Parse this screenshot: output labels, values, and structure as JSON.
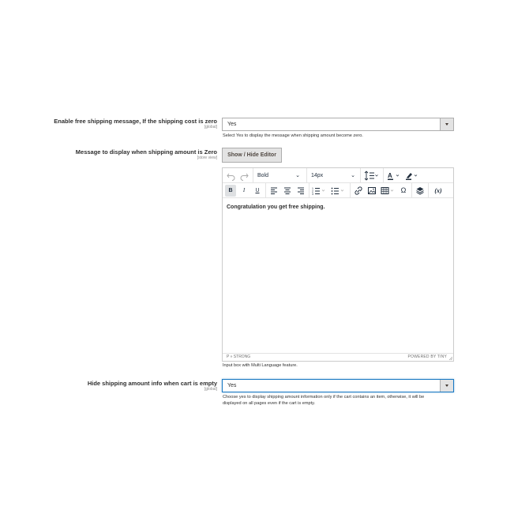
{
  "field_free_shipping": {
    "label": "Enable free shipping message, If the shipping cost is zero",
    "scope": "[global]",
    "value": "Yes",
    "note": "Select Yes to display the message when shipping amount become zero."
  },
  "field_message": {
    "label": "Message to display when shipping amount is Zero",
    "scope": "[store view]",
    "toggle_button": "Show / Hide Editor",
    "editor": {
      "format_select": "Bold",
      "size_select": "14px",
      "variable_button": "(x)",
      "content": "Congratulation you get free shipping.",
      "status_path": "P » STRONG",
      "branding": "POWERED BY TINY"
    },
    "note": "Input box with Multi Language feature."
  },
  "field_hide_empty": {
    "label": "Hide shipping amount info when cart is empty",
    "scope": "[global]",
    "value": "Yes",
    "note_line1": "Choose yes to display shipping amount information only if the cart contains an item, otherwise, it will be",
    "note_line2": "displayed on all pages even if the cart is empty."
  },
  "colors": {
    "focus_border": "#1979c3",
    "button_bg": "#e3e3e3",
    "text": "#303030"
  }
}
